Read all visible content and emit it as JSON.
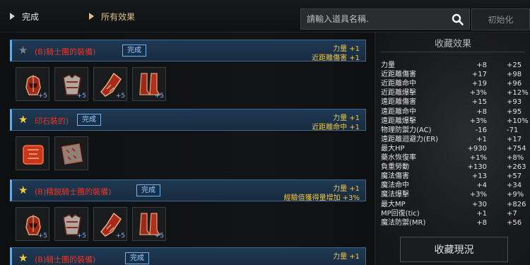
{
  "tabs": [
    {
      "label": "完成"
    },
    {
      "label": "所有效果"
    }
  ],
  "search": {
    "placeholder": "請輸入道具名稱."
  },
  "reset_label": "初始化",
  "done_badge": "完成",
  "sets": [
    {
      "name": "(B)騎士團的裝備)",
      "starred": false,
      "completed": true,
      "effects": [
        "力量 +1",
        "近距離傷害 +1"
      ],
      "items": [
        {
          "icon": "helmet-icon",
          "enchant": "+5"
        },
        {
          "icon": "armor-icon",
          "enchant": "+5"
        },
        {
          "icon": "gloves-icon",
          "enchant": "+5"
        },
        {
          "icon": "boots-icon",
          "enchant": "+5"
        }
      ]
    },
    {
      "name": "印石裝的)",
      "starred": true,
      "completed": true,
      "effects": [
        "力量 +1",
        "近距離命中 +1"
      ],
      "items": [
        {
          "icon": "red-seal-icon",
          "enchant": ""
        },
        {
          "icon": "rune-stone-icon",
          "enchant": ""
        }
      ]
    },
    {
      "name": "(B)精鋭騎士團的裝備)",
      "starred": true,
      "completed": true,
      "effects": [
        "力量 +1",
        "經驗值獲得量增加 +3%"
      ],
      "items": [
        {
          "icon": "helmet-icon",
          "enchant": "+5"
        },
        {
          "icon": "armor-icon",
          "enchant": "+5"
        },
        {
          "icon": "gloves-icon",
          "enchant": "+5"
        },
        {
          "icon": "boots-icon",
          "enchant": "+5"
        }
      ]
    },
    {
      "name": "(B)騎士團的裝備)",
      "starred": true,
      "completed": true,
      "effects": [
        "力量 +1"
      ],
      "items": []
    }
  ],
  "panel": {
    "title": "收藏效果",
    "stats": [
      {
        "name": "力量",
        "a": "+8",
        "b": "+25"
      },
      {
        "name": "近距離傷害",
        "a": "+17",
        "b": "+98"
      },
      {
        "name": "近距離命中",
        "a": "+19",
        "b": "+96"
      },
      {
        "name": "近距離爆擊",
        "a": "+3%",
        "b": "+12%"
      },
      {
        "name": "遠距離傷害",
        "a": "+15",
        "b": "+93"
      },
      {
        "name": "遠距離命中",
        "a": "+8",
        "b": "+95"
      },
      {
        "name": "遠距離爆擊",
        "a": "+3%",
        "b": "+10%"
      },
      {
        "name": "物理防禦力(AC)",
        "a": "-16",
        "b": "-71"
      },
      {
        "name": "遠距離迴避力(ER)",
        "a": "+1",
        "b": "+17"
      },
      {
        "name": "最大HP",
        "a": "+930",
        "b": "+754"
      },
      {
        "name": "藥水恢復率",
        "a": "+1%",
        "b": "+8%"
      },
      {
        "name": "負重勞動",
        "a": "+130",
        "b": "+263"
      },
      {
        "name": "魔法傷害",
        "a": "+13",
        "b": "+57"
      },
      {
        "name": "魔法命中",
        "a": "+4",
        "b": "+34"
      },
      {
        "name": "魔法爆擊",
        "a": "+3%",
        "b": "+9%"
      },
      {
        "name": "最大MP",
        "a": "+30",
        "b": "+826"
      },
      {
        "name": "MP回復(tic)",
        "a": "+1",
        "b": "+7"
      },
      {
        "name": "魔法防禦(MR)",
        "a": "+8",
        "b": "+56"
      }
    ]
  },
  "status_button": "收藏現況",
  "colors": {
    "accent": "#6aa9dc",
    "set_name": "#e23a2a",
    "effect": "#f2c742",
    "star": "#f4cf2f"
  }
}
